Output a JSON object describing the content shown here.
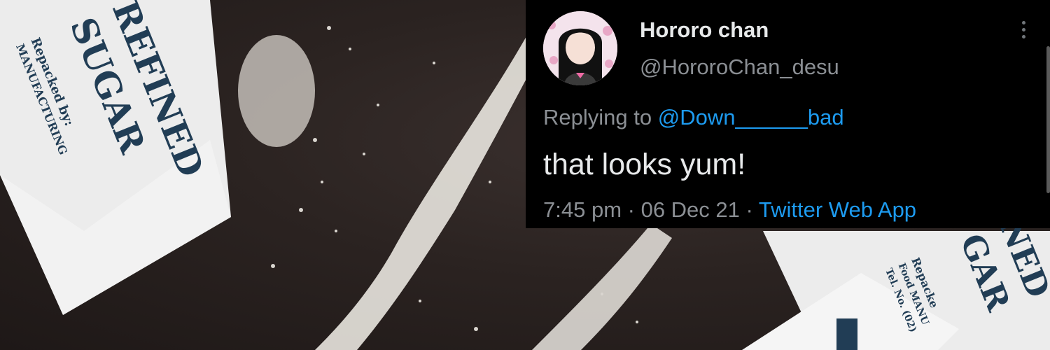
{
  "background": {
    "packet_left_lines": [
      "REFINED",
      "SUGAR",
      "Repacked by:",
      "MANUFACTURING"
    ],
    "packet_right_lines": [
      "NED",
      "GAR",
      "Repacke",
      "Food MANU",
      "Tel. No. (02)"
    ]
  },
  "tweet": {
    "display_name": "Hororo chan",
    "handle": "@HororoChan_desu",
    "replying_prefix": "Replying to ",
    "replying_to": "@Down______bad",
    "text": "that looks yum!",
    "time": "7:45 pm",
    "separator": " · ",
    "date": "06 Dec 21",
    "source": "Twitter Web App",
    "avatar_icon": "avatar-anime-girl-icon",
    "more_icon": "more-vertical-icon"
  },
  "colors": {
    "card_bg": "#000000",
    "primary_text": "#e7e9ea",
    "secondary_text": "#8b8f94",
    "accent": "#1d9bf0"
  }
}
